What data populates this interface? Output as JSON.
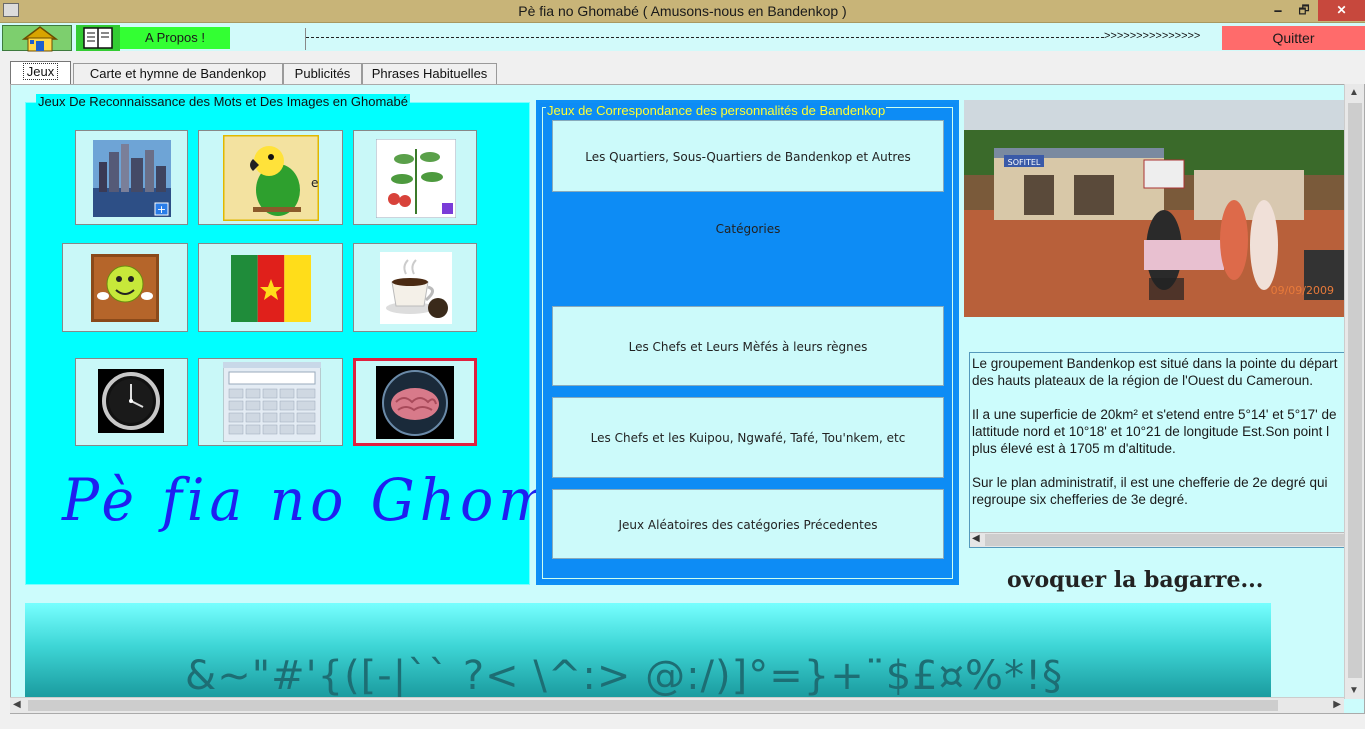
{
  "window": {
    "title": "Pè fia no Ghomabé ( Amusons-nous en Bandenkop )",
    "minimize": "🗕",
    "maximize": "🗗",
    "close": "✕"
  },
  "toolbar": {
    "apropos_label": "A Propos !",
    "marquee_arrows": ">>>>>>>>>>>>>>>",
    "quit_label": "Quitter"
  },
  "tabs": [
    {
      "label": "Jeux",
      "active": true
    },
    {
      "label": "Carte et hymne de Bandenkop",
      "active": false
    },
    {
      "label": "Publicités",
      "active": false
    },
    {
      "label": "Phrases Habituelles",
      "active": false
    }
  ],
  "left_group": {
    "legend": "Jeux De Reconnaissance des Mots  et  Des Images en Ghomabé",
    "tiles": [
      {
        "icon": "city-skyline-icon"
      },
      {
        "icon": "parrot-icon"
      },
      {
        "icon": "plant-icon"
      },
      {
        "icon": "smiley-icon"
      },
      {
        "icon": "cameroon-flag-icon"
      },
      {
        "icon": "coffee-cup-icon"
      },
      {
        "icon": "clock-icon"
      },
      {
        "icon": "calculator-icon"
      },
      {
        "icon": "brain-globe-icon"
      }
    ],
    "big_title": "Pè fia no Ghomabé"
  },
  "mid_group": {
    "legend": "Jeux de Correspondance des personnalités de Bandenkop",
    "buttons": [
      "Les Quartiers, Sous-Quartiers de Bandenkop et Autres Catégories",
      "Les Chefs et Leurs Mèfés à leurs règnes",
      "Les Chefs et les Kuipou, Ngwafé, Tafé, Tou'nkem, etc",
      "Jeux Aléatoires des catégories Précedentes"
    ]
  },
  "photo": {
    "date_stamp": "09/09/2009",
    "sign_text": "SOFITEL"
  },
  "info_text": {
    "p1_l1": "Le groupement Bandenkop est situé dans la pointe du départ",
    "p1_l2": "des hauts plateaux de la région de l'Ouest du Cameroun.",
    "p2_l1": "Il a une superficie de 20km² et s'etend entre 5°14' et 5°17' de",
    "p2_l2": "lattitude nord et 10°18' et 10°21 de longitude Est.Son point l",
    "p2_l3": "plus élevé est à 1705 m d'altitude.",
    "p3_l1": "Sur le plan administratif, il est une chefferie de 2e degré qui",
    "p3_l2": "regroupe six chefferies de 3e degré."
  },
  "scrolling_caption": "ovoquer la bagarre...",
  "band_text": "&~\"#'{([-|`` ?< \\^:> @:/)]°=}+¨$£¤%*!§",
  "colors": {
    "title_bar": "#c8b478",
    "panel_bg": "#ccfcfc",
    "cyan_group": "#00ffff",
    "blue_group": "#0d8cf5",
    "quit_button": "#ff6b6b",
    "apropos_button": "#33ff33"
  }
}
